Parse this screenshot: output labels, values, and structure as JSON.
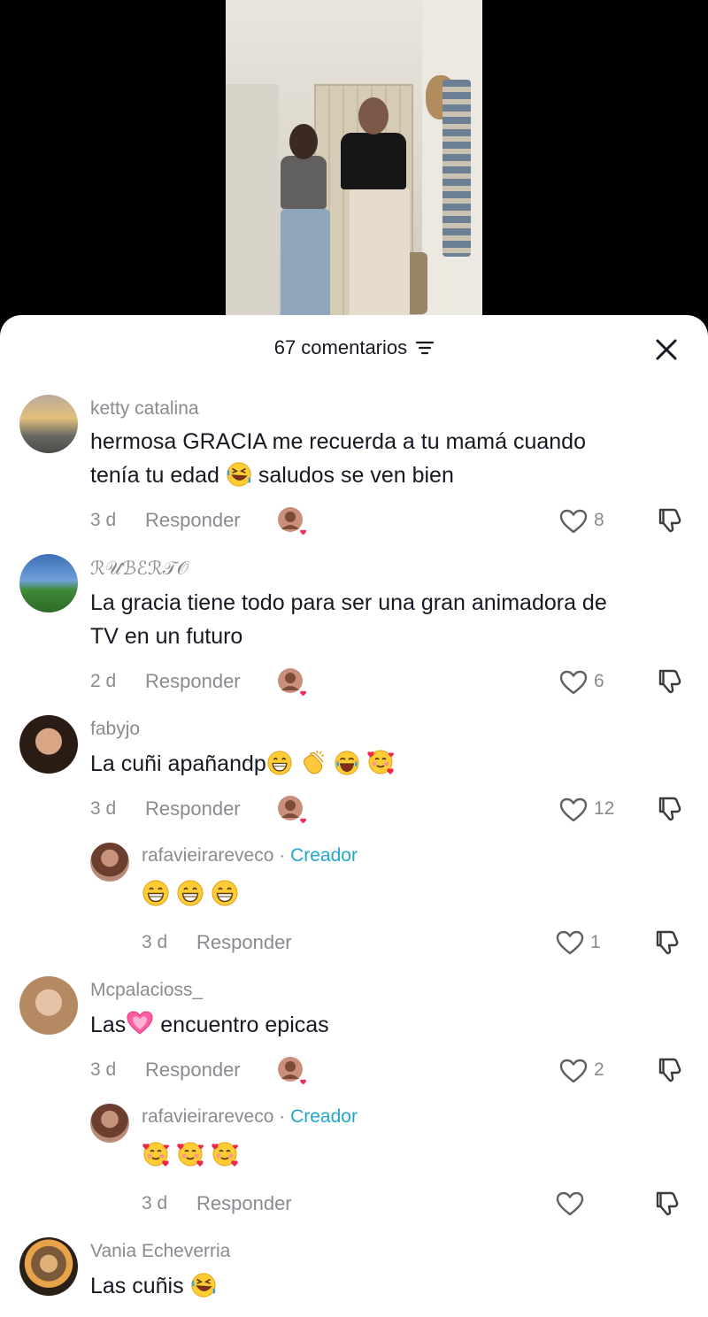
{
  "header": {
    "comment_count": "67 comentarios"
  },
  "colors": {
    "sheet_bg": "#ffffff",
    "text": "#161823",
    "muted": "#8a8b91",
    "creator": "#20a8cb",
    "heart": "#f02d5d"
  },
  "comments": [
    {
      "user": "ketty catalina",
      "text": "hermosa GRACIA me recuerda a tu mamá cuando",
      "text2": "tenía tu edad",
      "text2b": "saludos se ven bien",
      "emoji": "rofl",
      "age": "3 d",
      "reply": "Responder",
      "likes": "8"
    },
    {
      "user": "ℛ𝒰ℬℰℛ𝒯𝒪",
      "text": "La gracia tiene todo para ser una gran animadora de",
      "text2": "TV en un futuro",
      "age": "2 d",
      "reply": "Responder",
      "likes": "6"
    },
    {
      "user": "fabyjo",
      "text": "La cuñi apañandp",
      "emojis": [
        "grin",
        "clap",
        "joy",
        "hearts"
      ],
      "age": "3 d",
      "reply": "Responder",
      "likes": "12"
    },
    {
      "user": "Mcpalacioss_",
      "text_before": "Las",
      "text_after": "encuentro epicas",
      "emoji": "pink-heart",
      "age": "3 d",
      "reply": "Responder",
      "likes": "2"
    },
    {
      "user": "Vania Echeverria",
      "text": "Las cuñis",
      "emoji": "rofl"
    }
  ],
  "replies": [
    {
      "user": "rafavieirareveco",
      "separator": "·",
      "badge": "Creador",
      "emojis": [
        "grin",
        "grin",
        "grin"
      ],
      "age": "3 d",
      "reply": "Responder",
      "likes": "1"
    },
    {
      "user": "rafavieirareveco",
      "separator": "·",
      "badge": "Creador",
      "emojis": [
        "hearts",
        "hearts",
        "hearts"
      ],
      "age": "3 d",
      "reply": "Responder",
      "likes": ""
    }
  ]
}
